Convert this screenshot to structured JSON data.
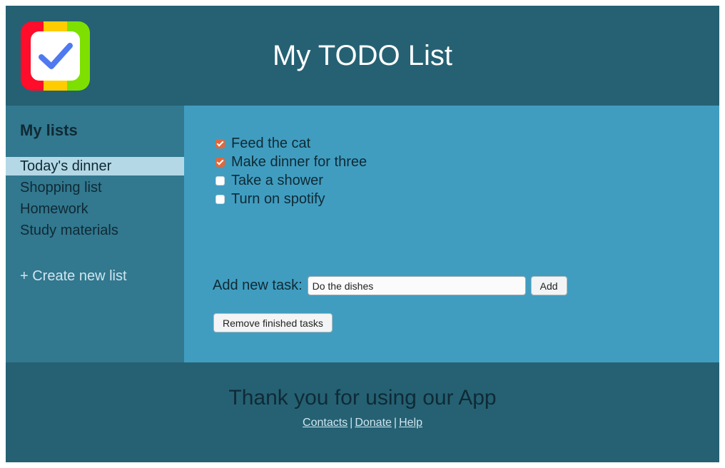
{
  "header": {
    "title": "My TODO List",
    "logo": {
      "icon": "checkmark-icon",
      "stripe_colors": [
        "#ff0d2b",
        "#ffcc00",
        "#7ee000"
      ],
      "check_color": "#4f79f0"
    }
  },
  "sidebar": {
    "heading": "My lists",
    "items": [
      {
        "label": "Today's dinner",
        "active": true
      },
      {
        "label": "Shopping list",
        "active": false
      },
      {
        "label": "Homework",
        "active": false
      },
      {
        "label": "Study materials",
        "active": false
      }
    ],
    "create_label": "+ Create new list"
  },
  "main": {
    "tasks": [
      {
        "label": "Feed the cat",
        "done": true
      },
      {
        "label": "Make dinner for three",
        "done": true
      },
      {
        "label": "Take a shower",
        "done": false
      },
      {
        "label": "Turn on spotify",
        "done": false
      }
    ],
    "add_label": "Add new task:",
    "input_value": "Do the dishes",
    "add_button": "Add",
    "remove_button": "Remove finished tasks"
  },
  "footer": {
    "thanks": "Thank you for using our App",
    "links": [
      "Contacts",
      "Donate",
      "Help"
    ],
    "separator": "|"
  },
  "colors": {
    "header_bg": "#256173",
    "sidebar_bg": "#32788f",
    "main_bg": "#409dc0",
    "active_item_bg": "#b4d8e6",
    "checkbox_checked": "#e0683c"
  }
}
